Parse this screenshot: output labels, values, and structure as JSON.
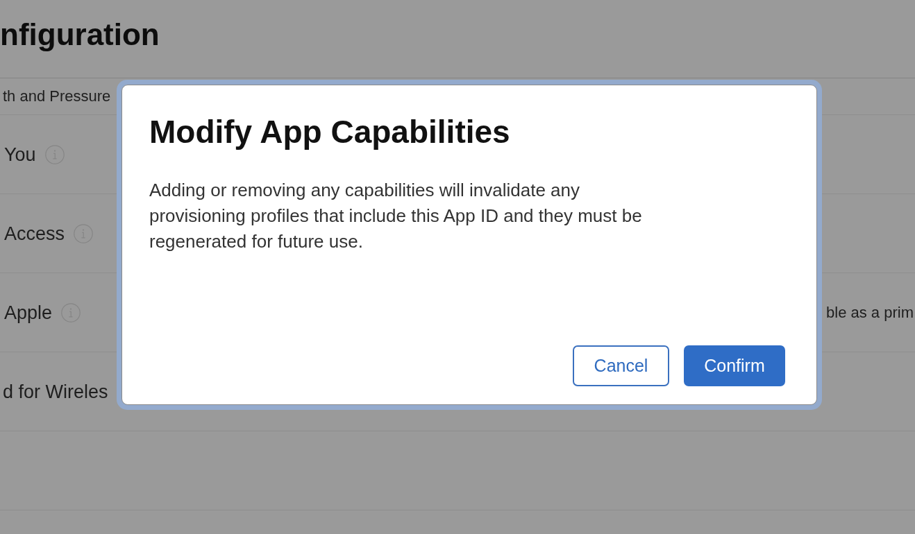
{
  "page": {
    "title": "nfiguration"
  },
  "capabilities": [
    {
      "kind": "partial",
      "label": "th and Pressure"
    },
    {
      "kind": "full",
      "label": "You"
    },
    {
      "kind": "full",
      "label": "Access"
    },
    {
      "kind": "full",
      "label": "Apple",
      "column_2": "ble as a prim"
    },
    {
      "kind": "cut",
      "label": "d for Wireles"
    }
  ],
  "dialog": {
    "title": "Modify App Capabilities",
    "message": "Adding or removing any capabilities will invalidate any provisioning profiles that include this App ID and they must be regenerated for future use.",
    "buttons": [
      {
        "kind": "secondary",
        "label": "Cancel"
      },
      {
        "kind": "primary",
        "label": "Confirm"
      }
    ]
  }
}
